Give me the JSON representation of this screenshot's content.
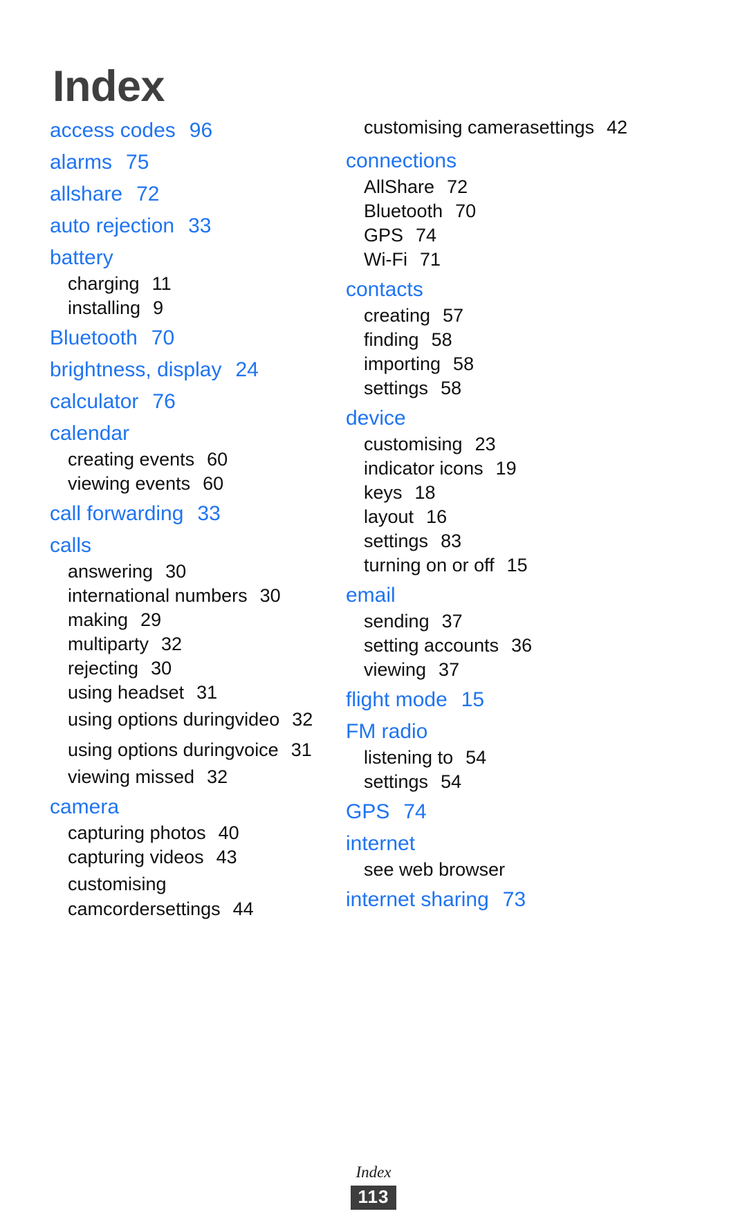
{
  "document": {
    "title": "Index",
    "footer_label": "Index",
    "page_number": "113"
  },
  "colors": {
    "main_entry": "#1f74f0",
    "sub_entry": "#101010",
    "title": "#3f3f3f",
    "page_box_background": "#3d3d3d"
  },
  "left_column": [
    {
      "type": "main",
      "label": "access codes",
      "page": "96"
    },
    {
      "type": "main",
      "label": "alarms",
      "page": "75"
    },
    {
      "type": "main",
      "label": "allshare",
      "page": "72"
    },
    {
      "type": "main",
      "label": "auto rejection",
      "page": "33"
    },
    {
      "type": "main",
      "label": "battery",
      "page": ""
    },
    {
      "type": "sub",
      "label": "charging",
      "page": "11"
    },
    {
      "type": "sub",
      "label": "installing",
      "page": "9"
    },
    {
      "type": "main",
      "label": "Bluetooth",
      "page": "70"
    },
    {
      "type": "main",
      "label": "brightness, display",
      "page": "24"
    },
    {
      "type": "main",
      "label": "calculator",
      "page": "76"
    },
    {
      "type": "main",
      "label": "calendar",
      "page": ""
    },
    {
      "type": "sub",
      "label": "creating events",
      "page": "60"
    },
    {
      "type": "sub",
      "label": "viewing events",
      "page": "60"
    },
    {
      "type": "main",
      "label": "call forwarding",
      "page": "33"
    },
    {
      "type": "main",
      "label": "calls",
      "page": ""
    },
    {
      "type": "sub",
      "label": "answering",
      "page": "30"
    },
    {
      "type": "sub",
      "label": "international numbers",
      "page": "30"
    },
    {
      "type": "sub",
      "label": "making",
      "page": "29"
    },
    {
      "type": "sub",
      "label": "multiparty",
      "page": "32"
    },
    {
      "type": "sub",
      "label": "rejecting",
      "page": "30"
    },
    {
      "type": "sub",
      "label": "using headset",
      "page": "31"
    },
    {
      "type": "sub",
      "label": "using options during",
      "label2": "video",
      "page": "32"
    },
    {
      "type": "sub",
      "label": "using options during",
      "label2": "voice",
      "page": "31"
    },
    {
      "type": "sub",
      "label": "viewing missed",
      "page": "32"
    },
    {
      "type": "main",
      "label": "camera",
      "page": ""
    },
    {
      "type": "sub",
      "label": "capturing photos",
      "page": "40"
    },
    {
      "type": "sub",
      "label": "capturing videos",
      "page": "43"
    },
    {
      "type": "sub",
      "label": "customising camcorder",
      "label2": "settings",
      "page": "44"
    }
  ],
  "right_column": [
    {
      "type": "sub",
      "label": "customising camera",
      "label2": "settings",
      "page": "42"
    },
    {
      "type": "main",
      "label": "connections",
      "page": ""
    },
    {
      "type": "sub",
      "label": "AllShare",
      "page": "72"
    },
    {
      "type": "sub",
      "label": "Bluetooth",
      "page": "70"
    },
    {
      "type": "sub",
      "label": "GPS",
      "page": "74"
    },
    {
      "type": "sub",
      "label": "Wi-Fi",
      "page": "71"
    },
    {
      "type": "main",
      "label": "contacts",
      "page": ""
    },
    {
      "type": "sub",
      "label": "creating",
      "page": "57"
    },
    {
      "type": "sub",
      "label": "finding",
      "page": "58"
    },
    {
      "type": "sub",
      "label": "importing",
      "page": "58"
    },
    {
      "type": "sub",
      "label": "settings",
      "page": "58"
    },
    {
      "type": "main",
      "label": "device",
      "page": ""
    },
    {
      "type": "sub",
      "label": "customising",
      "page": "23"
    },
    {
      "type": "sub",
      "label": "indicator icons",
      "page": "19"
    },
    {
      "type": "sub",
      "label": "keys",
      "page": "18"
    },
    {
      "type": "sub",
      "label": "layout",
      "page": "16"
    },
    {
      "type": "sub",
      "label": "settings",
      "page": "83"
    },
    {
      "type": "sub",
      "label": "turning on or off",
      "page": "15"
    },
    {
      "type": "main",
      "label": "email",
      "page": ""
    },
    {
      "type": "sub",
      "label": "sending",
      "page": "37"
    },
    {
      "type": "sub",
      "label": "setting accounts",
      "page": "36"
    },
    {
      "type": "sub",
      "label": "viewing",
      "page": "37"
    },
    {
      "type": "main",
      "label": "flight mode",
      "page": "15"
    },
    {
      "type": "main",
      "label": "FM radio",
      "page": ""
    },
    {
      "type": "sub",
      "label": "listening to",
      "page": "54"
    },
    {
      "type": "sub",
      "label": "settings",
      "page": "54"
    },
    {
      "type": "main",
      "label": "GPS",
      "page": "74"
    },
    {
      "type": "main",
      "label": "internet",
      "page": ""
    },
    {
      "type": "sub",
      "label": "see web browser",
      "page": ""
    },
    {
      "type": "main",
      "label": "internet sharing",
      "page": "73"
    }
  ]
}
